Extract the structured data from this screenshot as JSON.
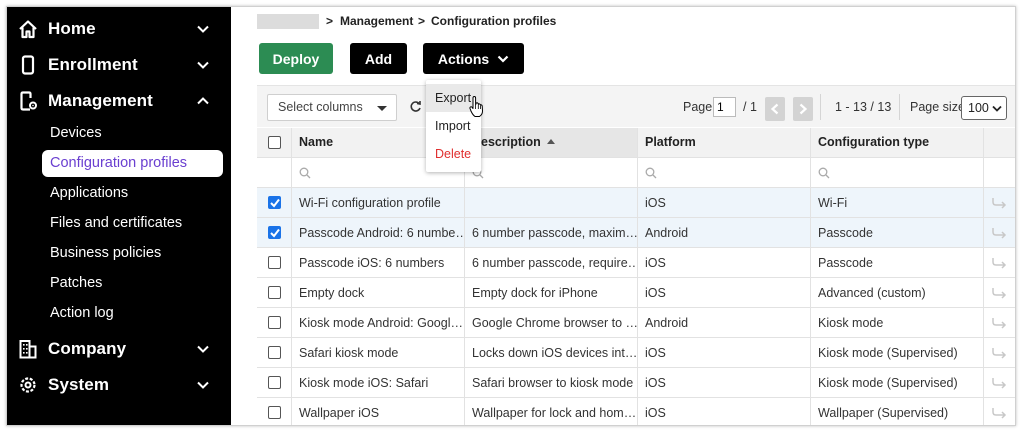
{
  "sidebar": {
    "nav": [
      {
        "label": "Home",
        "icon": "home-icon",
        "expanded": false
      },
      {
        "label": "Enrollment",
        "icon": "phone-icon",
        "expanded": false
      },
      {
        "label": "Management",
        "icon": "device-gear-icon",
        "expanded": true
      },
      {
        "label": "Company",
        "icon": "building-icon",
        "expanded": false
      },
      {
        "label": "System",
        "icon": "gear-icon",
        "expanded": false
      }
    ],
    "management_items": [
      {
        "label": "Devices",
        "active": false
      },
      {
        "label": "Configuration profiles",
        "active": true
      },
      {
        "label": "Applications",
        "active": false
      },
      {
        "label": "Files and certificates",
        "active": false
      },
      {
        "label": "Business policies",
        "active": false
      },
      {
        "label": "Patches",
        "active": false
      },
      {
        "label": "Action log",
        "active": false
      }
    ]
  },
  "breadcrumb": {
    "sep1": ">",
    "item1": "Management",
    "sep2": ">",
    "item2": "Configuration profiles"
  },
  "buttons": {
    "deploy": "Deploy",
    "add": "Add",
    "actions": "Actions"
  },
  "actions_menu": [
    {
      "label": "Export",
      "hover": true
    },
    {
      "label": "Import",
      "hover": false
    },
    {
      "label": "Delete",
      "danger": true
    }
  ],
  "toolbar": {
    "select_columns": "Select columns",
    "page_label": "Page",
    "page_value": "1",
    "page_total": "/ 1",
    "range": "1 - 13 / 13",
    "page_size_label": "Page size:",
    "page_size": "100"
  },
  "table": {
    "headers": [
      "Name",
      "Description",
      "Platform",
      "Configuration type"
    ],
    "sorted_column": "Description",
    "rows": [
      {
        "checked": true,
        "name": "Wi-Fi configuration profile",
        "description": "",
        "platform": "iOS",
        "type": "Wi-Fi"
      },
      {
        "checked": true,
        "name": "Passcode Android: 6 numbe…",
        "description": "6 number passcode, maxim…",
        "platform": "Android",
        "type": "Passcode"
      },
      {
        "checked": false,
        "name": "Passcode iOS: 6 numbers",
        "description": "6 number passcode, require…",
        "platform": "iOS",
        "type": "Passcode"
      },
      {
        "checked": false,
        "name": "Empty dock",
        "description": "Empty dock for iPhone",
        "platform": "iOS",
        "type": "Advanced (custom)"
      },
      {
        "checked": false,
        "name": "Kiosk mode Android: Googl…",
        "description": "Google Chrome browser to …",
        "platform": "Android",
        "type": "Kiosk mode"
      },
      {
        "checked": false,
        "name": "Safari kiosk mode",
        "description": "Locks down iOS devices int…",
        "platform": "iOS",
        "type": "Kiosk mode (Supervised)"
      },
      {
        "checked": false,
        "name": "Kiosk mode iOS: Safari",
        "description": "Safari browser to kiosk mode",
        "platform": "iOS",
        "type": "Kiosk mode (Supervised)"
      },
      {
        "checked": false,
        "name": "Wallpaper iOS",
        "description": "Wallpaper for lock and hom…",
        "platform": "iOS",
        "type": "Wallpaper (Supervised)"
      }
    ]
  },
  "colors": {
    "sidebar_bg": "#000000",
    "active_text": "#6a3fd0",
    "deploy_bg": "#2c8c53",
    "checkbox_on": "#1a73e8",
    "delete_text": "#e02f2f"
  }
}
